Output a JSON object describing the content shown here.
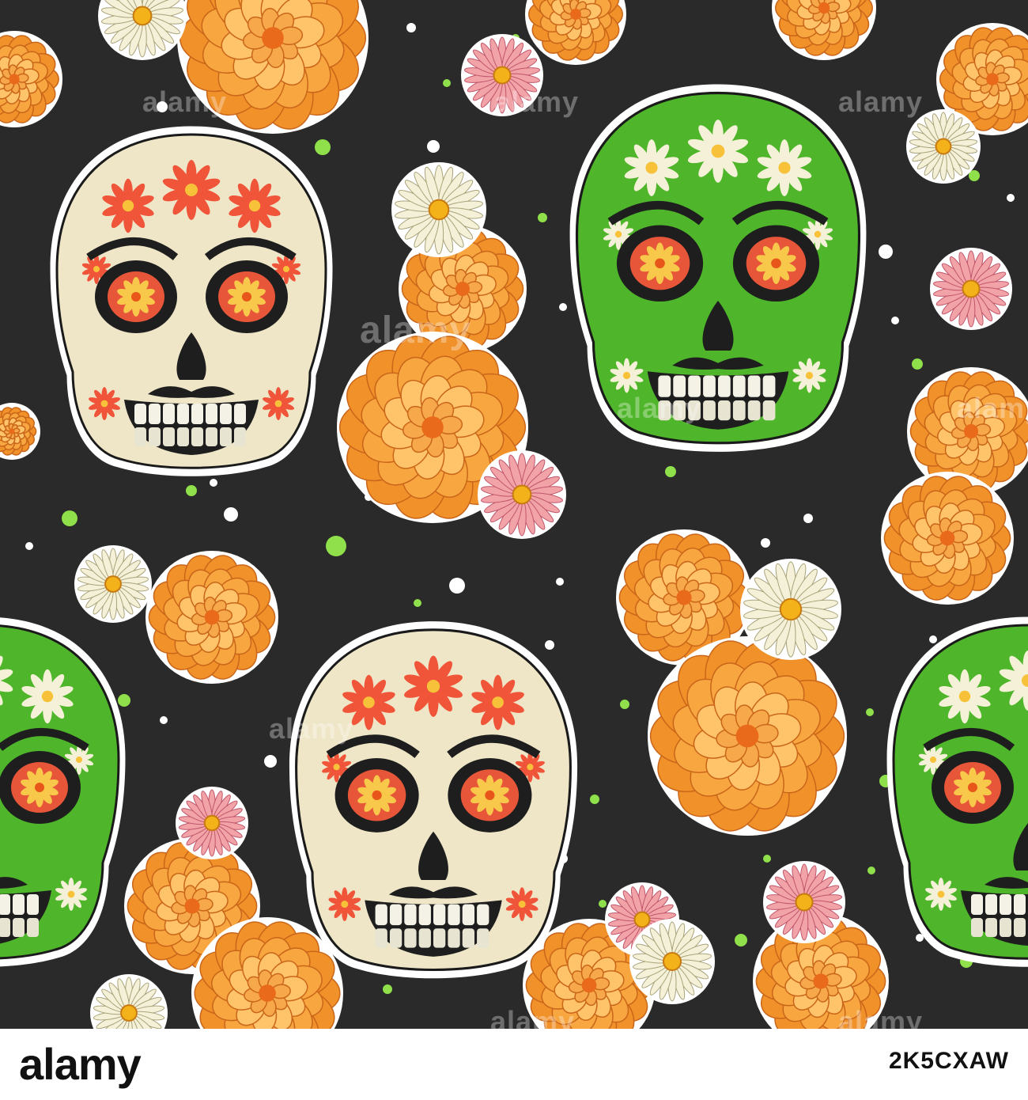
{
  "watermark": {
    "brand": "alamy",
    "image_id": "2K5CXAW"
  },
  "palette": {
    "background": "#2a2a2a",
    "marigold_outer": "#f0912a",
    "marigold_inner": "#ffc36a",
    "marigold_center": "#e86a1a",
    "skull_cream": "#efe6c8",
    "skull_green": "#4fb52a",
    "flower_red": "#f0553a",
    "daisy_white": "#f5f1d8",
    "daisy_pink": "#f2a3a8",
    "daisy_center": "#f3b21a",
    "dot_green": "#8fe04a",
    "dot_white": "#ffffff",
    "outline": "#ffffff"
  }
}
